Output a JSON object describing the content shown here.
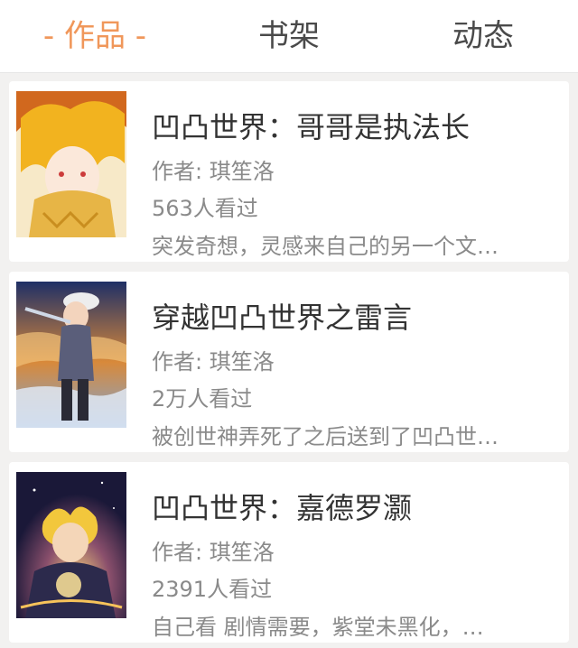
{
  "tabs": [
    {
      "label": "- 作品 -",
      "active": true
    },
    {
      "label": "书架",
      "active": false
    },
    {
      "label": "动态",
      "active": false
    }
  ],
  "colors": {
    "accent": "#f0975a",
    "text_primary": "#333333",
    "text_secondary": "#8a8a8a",
    "background": "#f2f1f0"
  },
  "works": [
    {
      "title": "凹凸世界：哥哥是执法长",
      "author": "作者: 琪笙洛",
      "views": "563人看过",
      "description": "突发奇想，灵感来自己的另一个文…",
      "cover_icon": "cover-image-1"
    },
    {
      "title": "穿越凹凸世界之雷言",
      "author": "作者: 琪笙洛",
      "views": "2万人看过",
      "description": "被创世神弄死了之后送到了凹凸世…",
      "cover_icon": "cover-image-2"
    },
    {
      "title": "凹凸世界：嘉德罗灏",
      "author": "作者: 琪笙洛",
      "views": "2391人看过",
      "description": "自己看  剧情需要，紫堂未黑化，…",
      "cover_icon": "cover-image-3"
    }
  ]
}
